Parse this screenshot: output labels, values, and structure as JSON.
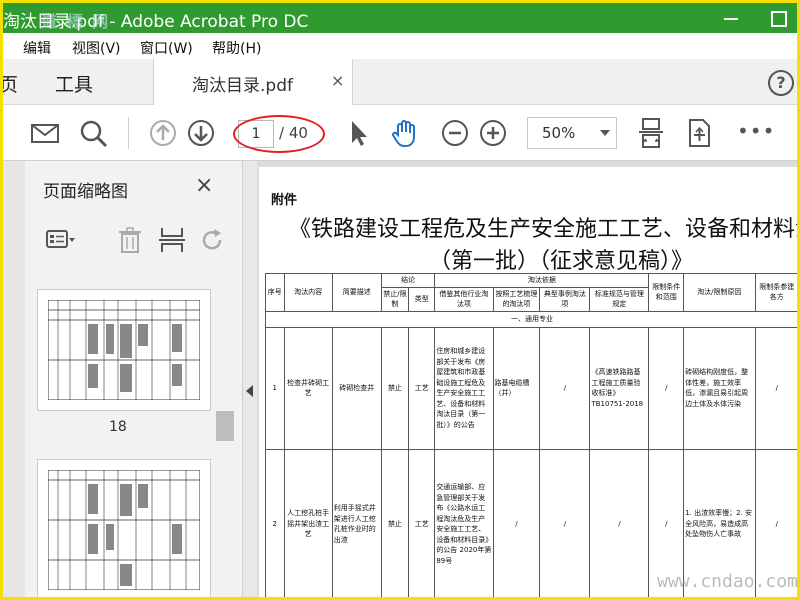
{
  "app": {
    "title": "淘汰目录.pdf - Adobe Acrobat Pro DC",
    "watermark_top": "道 標 网",
    "watermark_bottom": "www.cndao.com"
  },
  "menu": [
    "编辑",
    "视图(V)",
    "窗口(W)",
    "帮助(H)"
  ],
  "tabs": {
    "home_partial": "页",
    "tools": "工具",
    "document": "淘汰目录.pdf",
    "close": "×",
    "help": "?"
  },
  "toolbar": {
    "current_page": "1",
    "total_pages": "/ 40",
    "zoom": "50%",
    "more": "•••"
  },
  "panel": {
    "title": "页面缩略图",
    "close": "×",
    "thumb_label": "18"
  },
  "doc": {
    "label": "附件",
    "title_line1": "《铁路建设工程危及生产安全施工工艺、设备和材料淘",
    "title_line2": "（第一批）（征求意见稿）》",
    "header": {
      "seq": "序号",
      "content": "淘汰内容",
      "desc": "简要描述",
      "conclusion": "结论",
      "ban": "禁止/限制",
      "type": "类型",
      "basis": "淘汰依据",
      "other": "借鉴其他行业淘汰项",
      "process": "按照工艺梳理的淘汰项",
      "accident": "典型事例淘汰项",
      "standard": "标准规范与管理规定",
      "scope": "限制条件和范围",
      "reason": "淘汰/限制原因",
      "limit": "限制条参建各方"
    },
    "section": "一、通用专业",
    "rows": [
      {
        "seq": "1",
        "content": "检查井砖砌工艺",
        "desc": "砖砌检查井",
        "ban": "禁止",
        "type": "工艺",
        "other": "住房和城乡建设部关于发布《房屋建筑和市政基础设施工程危及生产安全施工工艺、设备和材料淘汰目录（第一批）》的公告",
        "process": "路基电缆槽（井）",
        "accident": "/",
        "standard": "《高速铁路路基工程施工质量验收标准》TB10751-2018",
        "scope": "/",
        "reason": "砖砌结构刚度低，整体性差，施工效率低，渗漏且易引起周边土体及水体污染",
        "limit": "/"
      },
      {
        "seq": "2",
        "content": "人工挖孔桩手摇井架出渣工艺",
        "desc": "利用手摇式井架进行人工挖孔桩作业时的出渣",
        "ban": "禁止",
        "type": "工艺",
        "other": "交通运输部、应急管理部关于发布《公路水运工程淘汰危及生产安全施工工艺、设备和材料目录》的公告 2020年第89号",
        "process": "/",
        "accident": "/",
        "standard": "/",
        "scope": "/",
        "reason": "1. 出渣效率慢；2. 安全风险高，易造成高处坠物伤人亡事故",
        "limit": "/"
      }
    ]
  },
  "colors": {
    "titlebar": "#2f9a2f",
    "frame": "#f2e100",
    "annotation": "#e02020",
    "accent_icon": "#1e73c8"
  }
}
